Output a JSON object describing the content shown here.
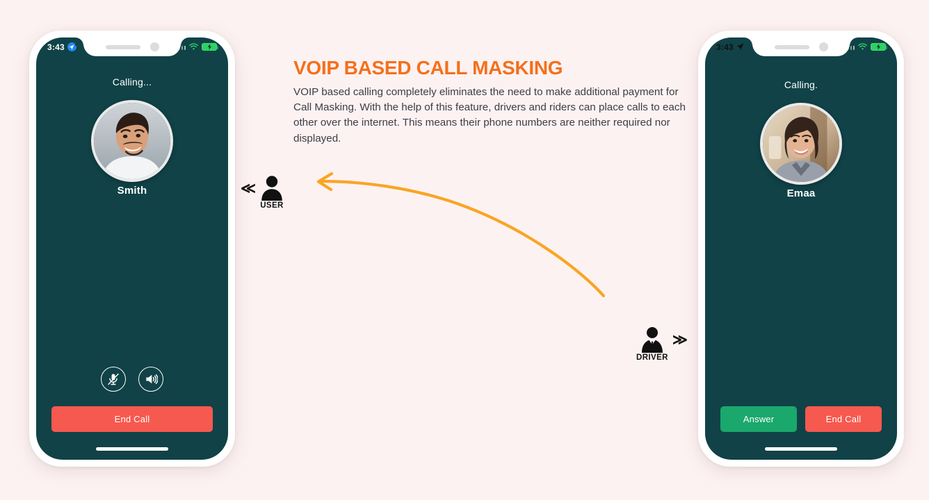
{
  "page": {
    "background_color": "#fdf2f2"
  },
  "article": {
    "headline": "VOIP BASED CALL MASKING",
    "headline_color": "#f4701b",
    "body": "VOIP based calling completely eliminates the need to make additional payment for Call Masking. With the help of this feature, drivers and riders can place calls to each other over the internet. This means their phone numbers are neither required nor displayed."
  },
  "phones": {
    "left": {
      "status_bar": {
        "time": "3:43",
        "location_icon": "location-arrow-icon",
        "signal_icon": "signal-bars-icon",
        "wifi_icon": "wifi-icon",
        "battery_icon": "battery-charging-icon",
        "time_color": "#ffffff"
      },
      "screen_color": "#104247",
      "call_status": "Calling...",
      "caller_name": "Smith",
      "avatar": "male-portrait-avatar",
      "controls": [
        {
          "name": "mute-button",
          "icon": "microphone-muted-icon"
        },
        {
          "name": "speaker-button",
          "icon": "speaker-on-icon"
        }
      ],
      "actions": [
        {
          "name": "end-call-button",
          "label": "End Call",
          "color": "#f6594f"
        }
      ]
    },
    "right": {
      "status_bar": {
        "time": "3:43",
        "location_icon": "location-arrow-icon",
        "signal_icon": "signal-bars-icon",
        "wifi_icon": "wifi-icon",
        "battery_icon": "battery-charging-icon",
        "time_color": "#111111"
      },
      "screen_color": "#104247",
      "call_status": "Calling.",
      "caller_name": "Emaa",
      "avatar": "female-portrait-avatar",
      "actions": [
        {
          "name": "answer-button",
          "label": "Answer",
          "color": "#1aa86c"
        },
        {
          "name": "end-call-button",
          "label": "End Call",
          "color": "#f6594f"
        }
      ]
    }
  },
  "personas": {
    "user": {
      "label": "USER",
      "icon": "person-icon",
      "chevron": "≪"
    },
    "driver": {
      "label": "DRIVER",
      "icon": "person-in-suit-icon",
      "chevron": "≫"
    }
  },
  "arrow": {
    "color": "#f9a524",
    "direction": "curved-right-to-left"
  }
}
